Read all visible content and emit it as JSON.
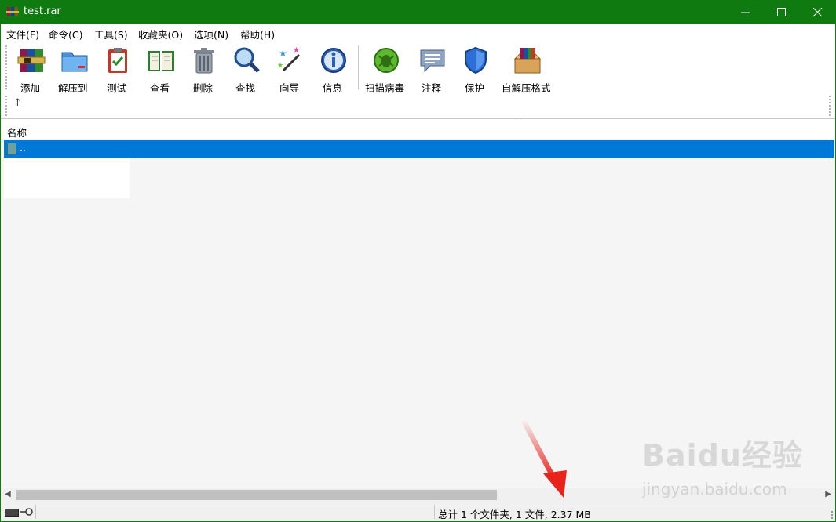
{
  "window": {
    "title": "test.rar",
    "title_color": "#0f7a10"
  },
  "menu": [
    "文件(F)",
    "命令(C)",
    "工具(S)",
    "收藏夹(O)",
    "选项(N)",
    "帮助(H)"
  ],
  "toolbar": {
    "buttons": [
      {
        "label": "添加",
        "icon": "archive-books-icon"
      },
      {
        "label": "解压到",
        "icon": "folder-extract-icon"
      },
      {
        "label": "测试",
        "icon": "clipboard-check-icon"
      },
      {
        "label": "查看",
        "icon": "open-book-icon"
      },
      {
        "label": "删除",
        "icon": "trash-can-icon"
      },
      {
        "label": "查找",
        "icon": "magnifier-icon"
      },
      {
        "label": "向导",
        "icon": "magic-wand-icon"
      },
      {
        "label": "信息",
        "icon": "info-icon"
      },
      {
        "label": "扫描病毒",
        "icon": "virus-scan-icon"
      },
      {
        "label": "注释",
        "icon": "comment-bubble-icon"
      },
      {
        "label": "保护",
        "icon": "shield-icon"
      },
      {
        "label": "自解压格式",
        "icon": "sfx-box-icon"
      }
    ],
    "up_arrow": "↑"
  },
  "list": {
    "column_name": "名称",
    "rows": [
      {
        "name": "..",
        "selected": true
      }
    ]
  },
  "status": {
    "text": "总计 1 个文件夹, 1 文件, 2.37 MB"
  },
  "watermark": {
    "main": "Baidu经验",
    "sub": "jingyan.baidu.com"
  },
  "colors": {
    "selection": "#0078d7",
    "list_bg": "#f5f5f5",
    "annotation_arrow": "#e8231c"
  }
}
